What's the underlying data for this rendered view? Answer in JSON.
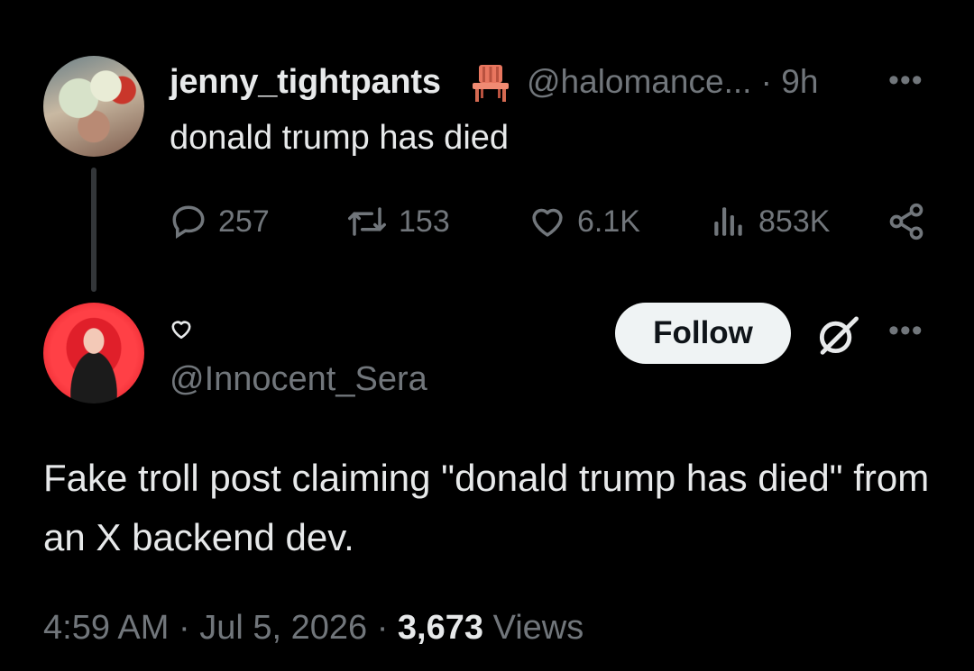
{
  "parent_tweet": {
    "display_name": "jenny_tightpants",
    "handle_and_time": "@halomance... · 9h",
    "text": "donald trump has died",
    "stats": {
      "replies": "257",
      "reposts": "153",
      "likes": "6.1K",
      "views": "853K"
    },
    "icons": [
      "chair-emoji-icon",
      "more-icon",
      "reply-icon",
      "repost-icon",
      "like-icon",
      "views-icon",
      "share-icon"
    ]
  },
  "main_tweet": {
    "display_name_icon": "heart-outline-icon",
    "handle": "@Innocent_Sera",
    "follow_label": "Follow",
    "text": "Fake troll post claiming \"donald trump has died\" from an X backend dev.",
    "time": "4:59 AM",
    "date": "Jul 5, 2026",
    "views_count": "3,673",
    "views_label": "Views",
    "separator": "·",
    "icons": [
      "grok-icon",
      "more-icon"
    ]
  },
  "colors": {
    "background": "#000000",
    "primary_text": "#e7e9ea",
    "secondary_text": "#71767b",
    "follow_button_bg": "#eff3f4",
    "chair_emoji": "#e8765f"
  }
}
